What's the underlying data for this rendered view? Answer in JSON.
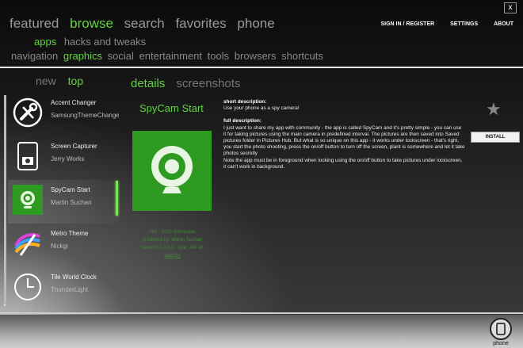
{
  "window": {
    "close_glyph": "x"
  },
  "nav": {
    "main": [
      "featured",
      "browse",
      "search",
      "favorites",
      "phone"
    ],
    "active": "browse"
  },
  "top_links": {
    "signin": "SIGN IN / REGISTER",
    "settings": "SETTINGS",
    "about": "ABOUT"
  },
  "sub_nav_1": {
    "items": [
      "apps",
      "hacks and tweaks"
    ],
    "active": "apps"
  },
  "sub_nav_2": {
    "items": [
      "navigation",
      "graphics",
      "social",
      "entertainment",
      "tools",
      "browsers",
      "shortcuts"
    ],
    "active": "graphics"
  },
  "list_tabs": {
    "items": [
      "new",
      "top"
    ],
    "active": "top"
  },
  "detail_tabs": {
    "items": [
      "details",
      "screenshots"
    ],
    "active": "details"
  },
  "app_list": [
    {
      "name": "Accent Changer",
      "author": "SamsungThemeChanger",
      "icon": "wrench-screwdriver-icon"
    },
    {
      "name": "Screen Capturer",
      "author": "Jerry Works",
      "icon": "phone-camera-icon"
    },
    {
      "name": "SpyCam Start",
      "author": "Martin Suchan",
      "icon": "webcam-icon",
      "selected": true
    },
    {
      "name": "Metro Theme",
      "author": "Nickgi",
      "icon": "paint-brush-icon"
    },
    {
      "name": "Tile World Clock",
      "author": "ThunderLight",
      "icon": "clock-icon"
    }
  ],
  "detail": {
    "title": "SpyCam Start",
    "icon": "webcam-icon",
    "downloads": "750 - 1000 downloads",
    "published_by": "published by: Martin Suchan",
    "version": "version: 1.0.0.0",
    "size": "size: 242 kb",
    "website": "website",
    "short_description_label": "short description:",
    "short_description": "Use your phone as a spy camera!",
    "full_description_label": "full description:",
    "full_description": "I just want to share my app with community - the app is called SpyCam and it's pretty simple - you can use it for taking pictures using the main camera in predefined interval. The pictures are then saved into Saved pictures folder in Pictures Hub. But what is so unique on this app - it works under lockscreen - that's right, you start the photo shooting, press the on/off button to turn off the screen, plant is somewhere and let it take photos secretly",
    "note": "Note the app must be in foreground when locking using the on/off button to take pictures under lockscreen, it can't work in background.",
    "install_label": "INSTALL",
    "favorite_icon": "star-icon"
  },
  "bottom": {
    "phone_label": "phone"
  },
  "colors": {
    "accent": "#5fd43e",
    "tile_green": "#2f9a21"
  }
}
